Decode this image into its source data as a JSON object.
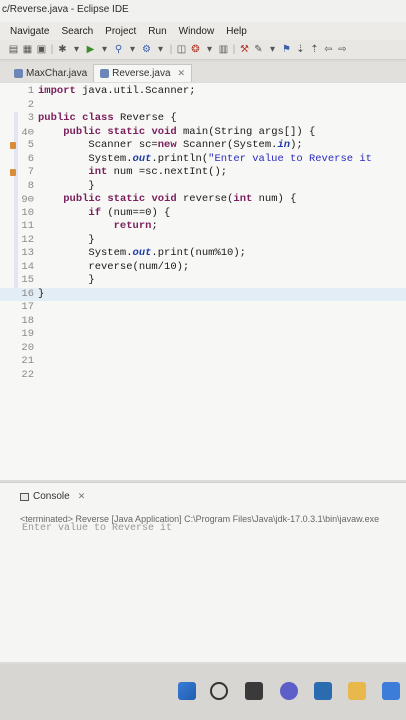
{
  "window": {
    "title": "c/Reverse.java - Eclipse IDE"
  },
  "menu": [
    "Navigate",
    "Search",
    "Project",
    "Run",
    "Window",
    "Help"
  ],
  "tabs": [
    {
      "label": "MaxChar.java",
      "active": false
    },
    {
      "label": "Reverse.java",
      "active": true
    }
  ],
  "editor": {
    "current_line": 16,
    "lines": [
      {
        "n": "1",
        "text": "import java.util.Scanner;"
      },
      {
        "n": "2",
        "text": ""
      },
      {
        "n": "3",
        "text": "public class Reverse {"
      },
      {
        "n": "4⊖",
        "text": "    public static void main(String args[]) {"
      },
      {
        "n": "5",
        "text": "        Scanner sc=new Scanner(System.in);"
      },
      {
        "n": "6",
        "text": "        System.out.println(\"Enter value to Reverse it"
      },
      {
        "n": "7",
        "text": "        int num =sc.nextInt();"
      },
      {
        "n": "8",
        "text": "        }"
      },
      {
        "n": "9⊖",
        "text": "    public static void reverse(int num) {"
      },
      {
        "n": "10",
        "text": "        if (num==0) {"
      },
      {
        "n": "11",
        "text": "            return;"
      },
      {
        "n": "12",
        "text": "        }"
      },
      {
        "n": "13",
        "text": "        System.out.print(num%10);"
      },
      {
        "n": "14",
        "text": "        reverse(num/10);"
      },
      {
        "n": "15",
        "text": "        }"
      },
      {
        "n": "16",
        "text": "}"
      },
      {
        "n": "17",
        "text": ""
      },
      {
        "n": "18",
        "text": ""
      },
      {
        "n": "19",
        "text": ""
      },
      {
        "n": "20",
        "text": ""
      },
      {
        "n": "21",
        "text": ""
      },
      {
        "n": "22",
        "text": ""
      }
    ]
  },
  "console": {
    "tab_label": "Console",
    "status": "<terminated> Reverse [Java Application] C:\\Program Files\\Java\\jdk-17.0.3.1\\bin\\javaw.exe",
    "output": "Enter value to Reverse it"
  },
  "colors": {
    "keyword": "#7a1f5c",
    "field": "#1f3ea8",
    "string": "#2a2ac0",
    "current_line": "#e3edf5"
  }
}
